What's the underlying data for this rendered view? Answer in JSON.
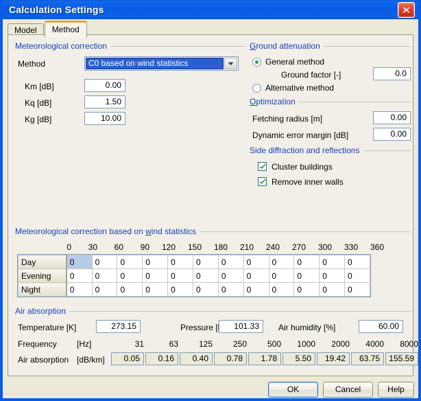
{
  "window": {
    "title": "Calculation Settings",
    "close_icon": "close-icon"
  },
  "tabs": [
    {
      "label": "Model",
      "active": false
    },
    {
      "label": "Method",
      "active": true
    }
  ],
  "meteorological_correction": {
    "group_label": "Meteorological correction",
    "method_label": "Method",
    "method_value": "C0 based on wind statistics",
    "fields": [
      {
        "label": "Km [dB]",
        "value": "0.00"
      },
      {
        "label": "Kq [dB]",
        "value": "1.50"
      },
      {
        "label": "Kg [dB]",
        "value": "10.00"
      }
    ]
  },
  "ground_attenuation": {
    "group_label": "Ground attenuation",
    "general_method_label": "General method",
    "general_method_selected": true,
    "ground_factor_label": "Ground factor [-]",
    "ground_factor_value": "0.0",
    "alternative_method_label": "Alternative method",
    "alternative_method_selected": false
  },
  "optimization": {
    "group_label": "Optimization",
    "fields": [
      {
        "label": "Fetching radius [m]",
        "value": "0.00"
      },
      {
        "label": "Dynamic error margin [dB]",
        "value": "0.00"
      }
    ]
  },
  "side_diffraction": {
    "group_label": "Side diffraction and reflections",
    "checkboxes": [
      {
        "label": "Cluster buildings",
        "checked": true
      },
      {
        "label": "Remove inner walls",
        "checked": true
      }
    ]
  },
  "wind_statistics": {
    "group_label": "Meteorological correction based on wind statistics",
    "column_headers": [
      "0",
      "30",
      "60",
      "90",
      "120",
      "150",
      "180",
      "210",
      "240",
      "270",
      "300",
      "330",
      "360"
    ],
    "rows": [
      {
        "label": "Day",
        "values": [
          "0",
          "0",
          "0",
          "0",
          "0",
          "0",
          "0",
          "0",
          "0",
          "0",
          "0",
          "0"
        ]
      },
      {
        "label": "Evening",
        "values": [
          "0",
          "0",
          "0",
          "0",
          "0",
          "0",
          "0",
          "0",
          "0",
          "0",
          "0",
          "0"
        ]
      },
      {
        "label": "Night",
        "values": [
          "0",
          "0",
          "0",
          "0",
          "0",
          "0",
          "0",
          "0",
          "0",
          "0",
          "0",
          "0"
        ]
      }
    ],
    "selected_cell": {
      "row": 0,
      "col": 0
    }
  },
  "air_absorption": {
    "group_label": "Air absorption",
    "temperature_label": "Temperature [K]",
    "temperature_value": "273.15",
    "pressure_label": "Pressure [kPa]",
    "pressure_value": "101.33",
    "humidity_label": "Air humidity [%]",
    "humidity_value": "60.00",
    "frequency_label": "Frequency",
    "frequency_unit": "[Hz]",
    "absorption_label": "Air absorption",
    "absorption_unit": "[dB/km]",
    "frequencies": [
      "31",
      "63",
      "125",
      "250",
      "500",
      "1000",
      "2000",
      "4000",
      "8000"
    ],
    "absorption_values": [
      "0.05",
      "0.16",
      "0.40",
      "0.78",
      "1.78",
      "5.50",
      "19.42",
      "63.75",
      "155.59"
    ]
  },
  "footer": {
    "ok_label": "OK",
    "cancel_label": "Cancel",
    "help_label": "Help"
  },
  "colors": {
    "titlebar": "#0a5ce8",
    "group_label": "#1a3fbf",
    "dialog_bg": "#ece9d8",
    "panel_bg": "#f1efe7",
    "selection": "#2a5fd4",
    "cell_selection": "#b6cbe8",
    "active_tab_accent": "#e8a33d",
    "field_border": "#7f9db9"
  }
}
